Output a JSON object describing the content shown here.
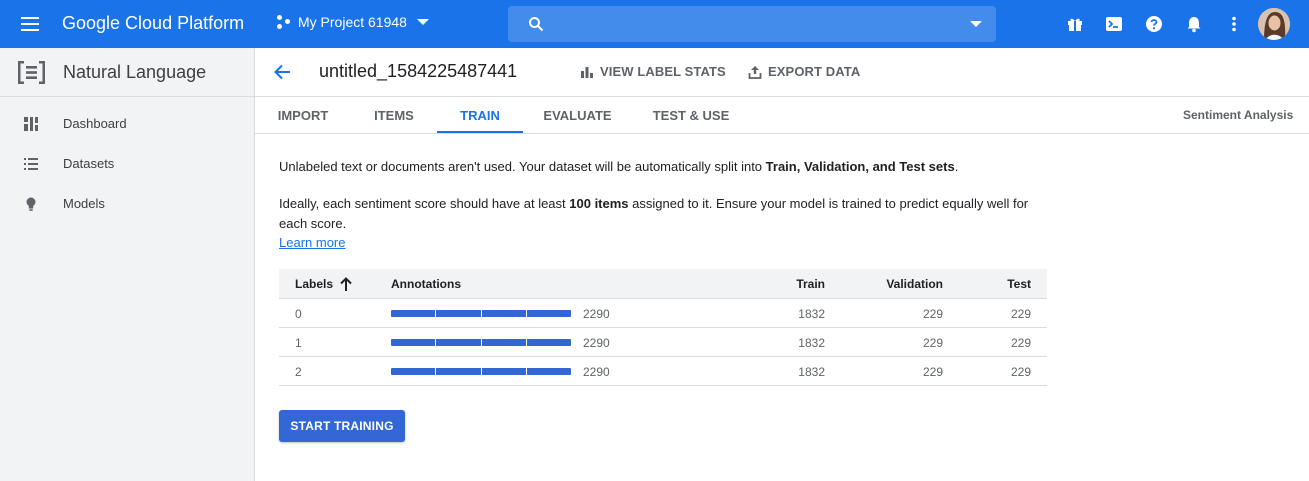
{
  "topbar": {
    "brand": "Google Cloud Platform",
    "project_name": "My Project 61948",
    "search_placeholder": "",
    "icons": [
      "menu-icon",
      "project-icon",
      "search-icon",
      "gift-icon",
      "cloud-shell-icon",
      "help-icon",
      "notifications-icon",
      "more-vert-icon",
      "avatar"
    ]
  },
  "sidebar": {
    "title": "Natural Language",
    "items": [
      {
        "label": "Dashboard",
        "icon": "dashboard-icon"
      },
      {
        "label": "Datasets",
        "icon": "list-icon"
      },
      {
        "label": "Models",
        "icon": "lightbulb-icon"
      }
    ]
  },
  "header": {
    "title": "untitled_1584225487441",
    "view_label_stats": "VIEW LABEL STATS",
    "export_data": "EXPORT DATA"
  },
  "tabs": {
    "items": [
      "IMPORT",
      "ITEMS",
      "TRAIN",
      "EVALUATE",
      "TEST & USE"
    ],
    "active": "TRAIN",
    "model_type": "Sentiment Analysis"
  },
  "content": {
    "para1_prefix": "Unlabeled text or documents aren't used. Your dataset will be automatically split into ",
    "para1_bold": "Train, Validation, and Test sets",
    "para1_suffix": ".",
    "para2_prefix": "Ideally, each sentiment score should have at least ",
    "para2_bold": "100 items",
    "para2_suffix": " assigned to it. Ensure your model is trained to predict equally well for each score.",
    "learn_more": "Learn more"
  },
  "table": {
    "headers": {
      "labels": "Labels",
      "annotations": "Annotations",
      "train": "Train",
      "validation": "Validation",
      "test": "Test"
    },
    "rows": [
      {
        "label": "0",
        "annotations": "2290",
        "train": "1832",
        "validation": "229",
        "test": "229"
      },
      {
        "label": "1",
        "annotations": "2290",
        "train": "1832",
        "validation": "229",
        "test": "229"
      },
      {
        "label": "2",
        "annotations": "2290",
        "train": "1832",
        "validation": "229",
        "test": "229"
      }
    ]
  },
  "actions": {
    "start_training": "START TRAINING"
  },
  "colors": {
    "topbar": "#1a73e8",
    "accent": "#1a73e8",
    "button": "#3367d6",
    "sidebar_bg": "#f1f3f4"
  }
}
